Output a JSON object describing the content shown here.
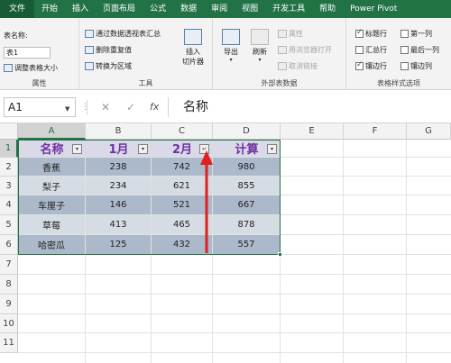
{
  "ribbon": {
    "tabs": [
      "文件",
      "开始",
      "插入",
      "页面布局",
      "公式",
      "数据",
      "审阅",
      "视图",
      "开发工具",
      "帮助",
      "Power Pivot"
    ],
    "properties": {
      "table_name_label": "表名称:",
      "table_name_value": "表1",
      "resize_label": "调整表格大小",
      "group_label": "属性"
    },
    "tools": {
      "pivot_label": "通过数据透视表汇总",
      "remove_dup_label": "删除重复值",
      "convert_label": "转换为区域",
      "slicer_label_1": "插入",
      "slicer_label_2": "切片器",
      "group_label": "工具"
    },
    "external": {
      "export_label": "导出",
      "refresh_label": "刷新",
      "properties_label": "属性",
      "open_browser_label": "用浏览器打开",
      "unlink_label": "取消链接",
      "group_label": "外部表数据"
    },
    "style_options": {
      "options": [
        {
          "label": "标题行",
          "checked": true
        },
        {
          "label": "第一列",
          "checked": false
        },
        {
          "label": "汇总行",
          "checked": false
        },
        {
          "label": "最后一列",
          "checked": false
        },
        {
          "label": "镶边行",
          "checked": true
        },
        {
          "label": "镶边列",
          "checked": false
        }
      ],
      "group_label": "表格样式选项"
    }
  },
  "formula_bar": {
    "name_box": "A1",
    "cancel_icon": "✕",
    "enter_icon": "✓",
    "fx_label": "fx",
    "content": "名称"
  },
  "grid": {
    "columns": [
      "A",
      "B",
      "C",
      "D",
      "E",
      "F",
      "G"
    ],
    "rows": [
      "1",
      "2",
      "3",
      "4",
      "5",
      "6",
      "7",
      "8",
      "9",
      "10",
      "11"
    ],
    "table": {
      "headers": [
        "名称",
        "1月",
        "2月",
        "计算"
      ],
      "sorted_column_indicator": "↵",
      "data": [
        [
          "香蕉",
          "238",
          "742",
          "980"
        ],
        [
          "梨子",
          "234",
          "621",
          "855"
        ],
        [
          "车厘子",
          "146",
          "521",
          "667"
        ],
        [
          "草莓",
          "413",
          "465",
          "878"
        ],
        [
          "哈密瓜",
          "125",
          "432",
          "557"
        ]
      ]
    },
    "colors": {
      "accent": "#217346",
      "header_text": "#7030a0",
      "band_dark": "#acb9ca",
      "band_light": "#d6dce4",
      "arrow": "#e0201e"
    }
  }
}
